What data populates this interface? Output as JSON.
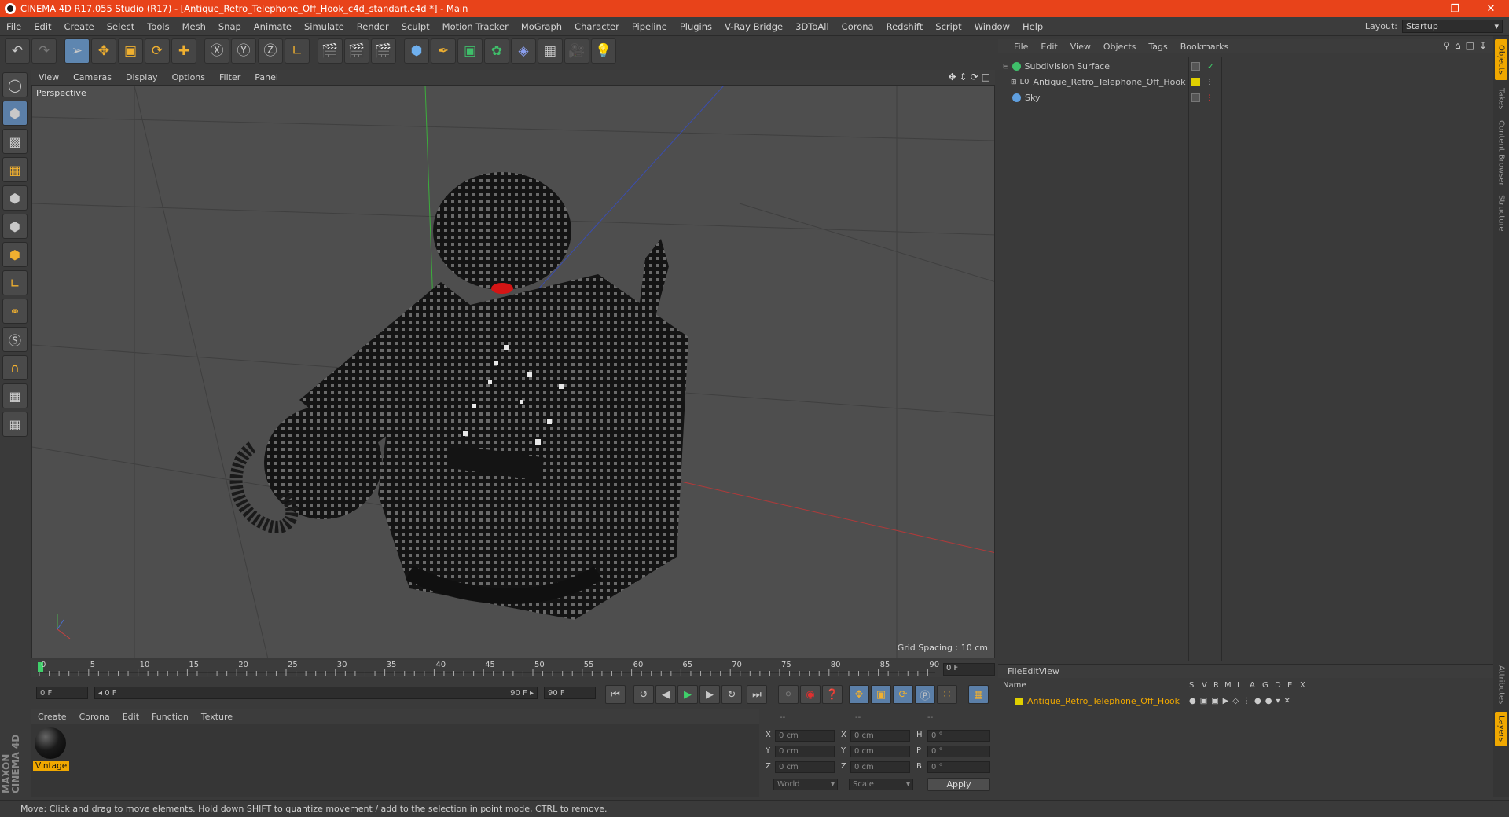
{
  "titlebar": {
    "title": "CINEMA 4D R17.055 Studio (R17) - [Antique_Retro_Telephone_Off_Hook_c4d_standart.c4d *] - Main"
  },
  "menubar": {
    "items": [
      "File",
      "Edit",
      "Create",
      "Select",
      "Tools",
      "Mesh",
      "Snap",
      "Animate",
      "Simulate",
      "Render",
      "Sculpt",
      "Motion Tracker",
      "MoGraph",
      "Character",
      "Pipeline",
      "Plugins",
      "V-Ray Bridge",
      "3DToAll",
      "Corona",
      "Redshift",
      "Script",
      "Window",
      "Help"
    ],
    "layout_label": "Layout:",
    "layout_value": "Startup"
  },
  "viewport": {
    "menu": [
      "View",
      "Cameras",
      "Display",
      "Options",
      "Filter",
      "Panel"
    ],
    "label": "Perspective",
    "grid_spacing": "Grid Spacing : 10 cm"
  },
  "timeline": {
    "ticks": [
      "0",
      "5",
      "10",
      "15",
      "20",
      "25",
      "30",
      "35",
      "40",
      "45",
      "50",
      "55",
      "60",
      "65",
      "70",
      "75",
      "80",
      "85",
      "90"
    ],
    "end_frame": "0 F",
    "start_field": "0 F",
    "range_start": "◂ 0 F",
    "range_end": "90 F ▸",
    "end_field": "90 F"
  },
  "material_manager": {
    "menu": [
      "Create",
      "Corona",
      "Edit",
      "Function",
      "Texture"
    ],
    "material_name": "Vintage"
  },
  "coordinates": {
    "header": [
      "--",
      "--",
      "--"
    ],
    "rows": [
      {
        "a": "X",
        "av": "0 cm",
        "b": "X",
        "bv": "0 cm",
        "c": "H",
        "cv": "0 °"
      },
      {
        "a": "Y",
        "av": "0 cm",
        "b": "Y",
        "bv": "0 cm",
        "c": "P",
        "cv": "0 °"
      },
      {
        "a": "Z",
        "av": "0 cm",
        "b": "Z",
        "bv": "0 cm",
        "c": "B",
        "cv": "0 °"
      }
    ],
    "mode_world": "World",
    "mode_scale": "Scale",
    "apply": "Apply"
  },
  "object_manager": {
    "menu": [
      "File",
      "Edit",
      "View",
      "Objects",
      "Tags",
      "Bookmarks"
    ],
    "objects": [
      {
        "name": "Subdivision Surface",
        "color": "#3fbf6a"
      },
      {
        "name": "Antique_Retro_Telephone_Off_Hook",
        "color": "#e0d000"
      },
      {
        "name": "Sky",
        "color": "#5f9fdf"
      }
    ]
  },
  "layer_manager": {
    "menu": [
      "File",
      "Edit",
      "View"
    ],
    "header_name": "Name",
    "header_cols": [
      "S",
      "V",
      "R",
      "M",
      "L",
      "A",
      "G",
      "D",
      "E",
      "X"
    ],
    "layer_name": "Antique_Retro_Telephone_Off_Hook",
    "layer_color": "#f0a800"
  },
  "side_tabs": [
    "Objects",
    "Takes",
    "Content Browser",
    "Structure"
  ],
  "side_tabs_bottom": [
    "Attributes",
    "Layers"
  ],
  "brand": "MAXON CINEMA 4D",
  "status": "Move: Click and drag to move elements. Hold down SHIFT to quantize movement / add to the selection in point mode, CTRL to remove.",
  "colors": {
    "accent": "#e8431a",
    "selection": "#f0a800",
    "tool_blue": "#5b7fa8"
  }
}
